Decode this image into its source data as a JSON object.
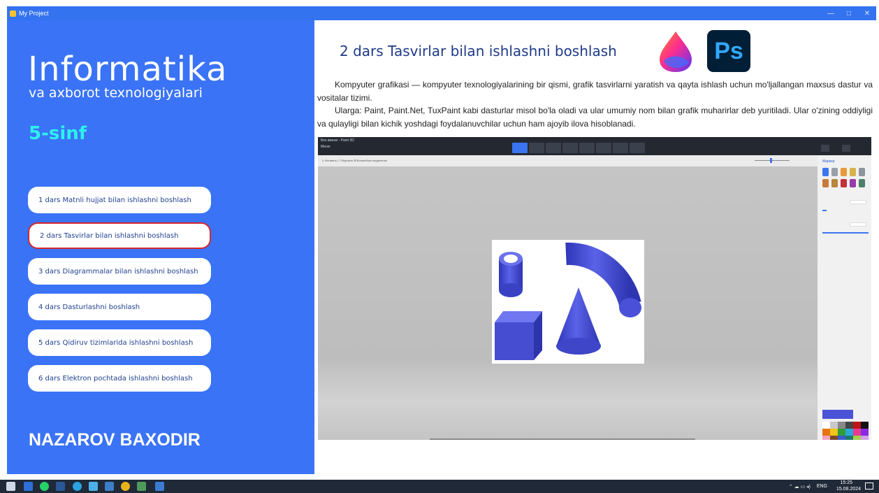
{
  "window": {
    "title": "My Project",
    "minimize": "—",
    "maximize": "□",
    "close": "✕"
  },
  "sidebar": {
    "subject": "Informatika",
    "subtitle": "va axborot texnologiyalari",
    "grade": "5-sinf",
    "lessons": [
      "1 dars Matnli hujjat bilan ishlashni boshlash",
      "2 dars Tasvirlar bilan ishlashni boshlash",
      "3 dars Diagrammalar bilan ishlashni boshlash",
      "4 dars Dasturlashni boshlash",
      "5 dars Qidiruv tizimlarida ishlashni boshlash",
      "6 dars Elektron pochtada ishlashni boshlash"
    ],
    "author": "NAZAROV BAXODIR"
  },
  "main": {
    "title": "2 dars Tasvirlar bilan ishlashni boshlash",
    "ps_logo": "Ps",
    "paragraph1": "Kompyuter grafikasi — kompyuter texnologiyalarining bir qismi, grafik tasvirlarni yaratish va qayta ishlash uchun mo'ljallangan maxsus dastur va vositalar tizimi.",
    "paragraph2": "Ularga: Paint, Paint.Net, TuxPaint kabi dasturlar misol bo'la oladi va ular umumiy nom bilan grafik muharirlar deb yuritiladi. Ular o'zining oddiyligi va qulayligi bilan kichik yoshdagi foydalanuvchilar uchun ham ajoyib ilova hisoblanadi.",
    "paint3d": {
      "window_title": "Без имени - Paint 3D",
      "menu": "Меню",
      "toolbar_left": "▷ Вставить    ⤢ Обрезать    ⊞ Волшебное выделение",
      "panel_title": "Маркер"
    }
  },
  "nav": {
    "home": "home",
    "prev": "previous",
    "next": "next"
  },
  "taskbar": {
    "lang": "ENG",
    "time": "15:25",
    "date": "15.08.2024"
  },
  "colors": {
    "sidebar_bg": "#3a73f6",
    "grade": "#2ef0ec",
    "active_border": "#d4282c",
    "nav_green": "#138d2e",
    "title_blue": "#1f3a88"
  }
}
